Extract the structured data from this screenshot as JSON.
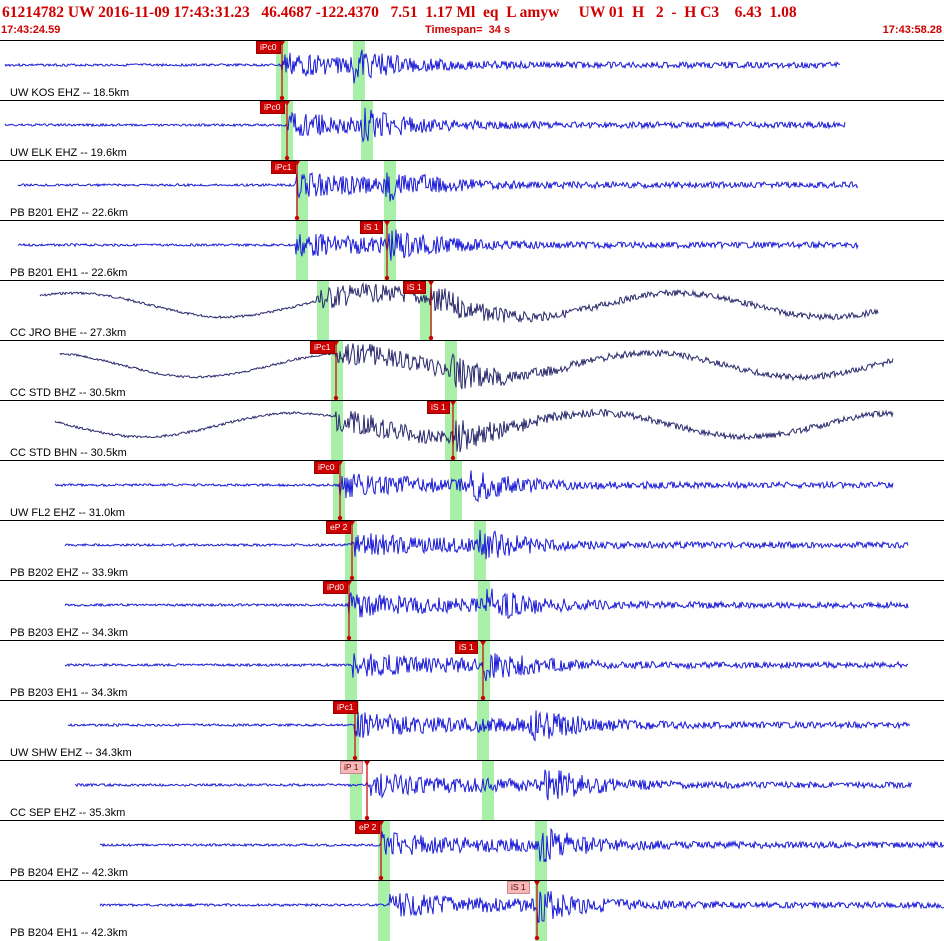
{
  "header": {
    "title": "61214782 UW 2016-11-09 17:43:31.23   46.4687 -122.4370   7.51  1.17 Ml  eq  L amyw     UW 01  H   2  -  H C3    6.43  1.08",
    "start_time": "17:43:24.59",
    "timespan": "Timespan=  34 s",
    "end_time": "17:43:58.28"
  },
  "colors": {
    "trace_blue": "#1a1ad8",
    "trace_dark": "#2a2a6e",
    "pick_red": "#cc0000",
    "window_green": "#a8f0a8",
    "header_red": "#d00000"
  },
  "channels": [
    {
      "label": "UW KOS EHZ -- 18.5km",
      "pick_label": "iPc0",
      "pick_style": "solid",
      "color": "#1a1ad8"
    },
    {
      "label": "UW ELK EHZ -- 19.6km",
      "pick_label": "iPc0",
      "pick_style": "solid",
      "color": "#1a1ad8"
    },
    {
      "label": "PB B201 EHZ -- 22.6km",
      "pick_label": "iPc1",
      "pick_style": "solid",
      "color": "#1a1ad8"
    },
    {
      "label": "PB B201 EH1 -- 22.6km",
      "pick_label": "iS 1",
      "pick_style": "solid",
      "color": "#1a1ad8"
    },
    {
      "label": "CC JRO BHE -- 27.3km",
      "pick_label": "iS 1",
      "pick_style": "solid",
      "color": "#2a2a6e"
    },
    {
      "label": "CC STD BHZ -- 30.5km",
      "pick_label": "iPc1",
      "pick_style": "solid",
      "color": "#2a2a6e"
    },
    {
      "label": "CC STD BHN -- 30.5km",
      "pick_label": "iS 1",
      "pick_style": "solid",
      "color": "#2a2a6e"
    },
    {
      "label": "UW FL2 EHZ -- 31.0km",
      "pick_label": "iPc0",
      "pick_style": "solid",
      "color": "#1a1ad8"
    },
    {
      "label": "PB B202 EHZ -- 33.9km",
      "pick_label": "eP 2",
      "pick_style": "solid",
      "color": "#1a1ad8"
    },
    {
      "label": "PB B203 EHZ -- 34.3km",
      "pick_label": "iPd0",
      "pick_style": "solid",
      "color": "#1a1ad8"
    },
    {
      "label": "PB B203 EH1 -- 34.3km",
      "pick_label": "iS 1",
      "pick_style": "solid",
      "color": "#1a1ad8"
    },
    {
      "label": "UW SHW EHZ -- 34.3km",
      "pick_label": "iPc1",
      "pick_style": "solid",
      "color": "#1a1ad8"
    },
    {
      "label": "CC SEP EHZ -- 35.3km",
      "pick_label": "iP 1",
      "pick_style": "pale",
      "color": "#1a1ad8"
    },
    {
      "label": "PB B204 EHZ -- 42.3km",
      "pick_label": "eP 2",
      "pick_style": "solid",
      "color": "#1a1ad8"
    },
    {
      "label": "PB B204 EH1 -- 42.3km",
      "pick_label": "iS 1",
      "pick_style": "pale",
      "color": "#1a1ad8"
    }
  ]
}
